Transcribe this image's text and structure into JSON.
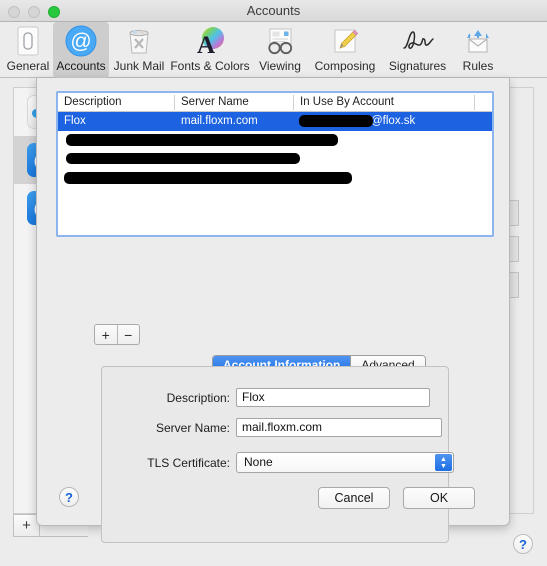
{
  "window": {
    "title": "Accounts",
    "controls": [
      {
        "name": "close-button",
        "color": "#d5d5d5"
      },
      {
        "name": "minimize-button",
        "color": "#d5d5d5"
      },
      {
        "name": "zoom-button",
        "color": "#28c83c"
      }
    ]
  },
  "toolbar": {
    "items": [
      {
        "label": "General",
        "icon": "general-icon",
        "selected": false
      },
      {
        "label": "Accounts",
        "icon": "accounts-at-icon",
        "selected": true
      },
      {
        "label": "Junk Mail",
        "icon": "junk-mail-icon",
        "selected": false
      },
      {
        "label": "Fonts & Colors",
        "icon": "fonts-colors-icon",
        "selected": false
      },
      {
        "label": "Viewing",
        "icon": "viewing-glasses-icon",
        "selected": false
      },
      {
        "label": "Composing",
        "icon": "composing-pencil-icon",
        "selected": false
      },
      {
        "label": "Signatures",
        "icon": "signature-icon",
        "selected": false
      },
      {
        "label": "Rules",
        "icon": "rules-envelope-icon",
        "selected": false
      }
    ]
  },
  "background": {
    "sidebar_accounts": [
      {
        "icon": "icloud-icon",
        "selected": false
      },
      {
        "icon": "mail-at-icon",
        "selected": true
      },
      {
        "icon": "mail-at-icon",
        "selected": false
      }
    ],
    "add_account_label": "+",
    "help_label": "?"
  },
  "sheet": {
    "table": {
      "columns": [
        "Description",
        "Server Name",
        "In Use By Account"
      ],
      "rows": [
        {
          "selected": true,
          "description": "Flox",
          "server_name": "mail.floxm.com",
          "in_use_by_account": "@flox.sk",
          "account_redacted": true
        },
        {
          "selected": false,
          "redacted_row": true,
          "redaction_width": 272
        },
        {
          "selected": false,
          "redacted_row": true,
          "redaction_width": 234
        },
        {
          "selected": false,
          "redacted_row": true,
          "redaction_width": 288
        }
      ]
    },
    "add_button_label": "+",
    "remove_button_label": "−",
    "tabs": [
      {
        "label": "Account Information",
        "active": true
      },
      {
        "label": "Advanced",
        "active": false
      }
    ],
    "fields": [
      {
        "label": "Description:",
        "value": "Flox",
        "type": "text"
      },
      {
        "label": "Server Name:",
        "value": "mail.floxm.com",
        "type": "text"
      },
      {
        "label": "TLS Certificate:",
        "value": "None",
        "type": "popup"
      }
    ],
    "help_label": "?",
    "cancel_label": "Cancel",
    "ok_label": "OK"
  },
  "colors": {
    "selection_blue": "#1d62e0",
    "focus_ring": "#8cb4ee",
    "window_bg": "#ececec",
    "accent": "#1c6fe3"
  }
}
